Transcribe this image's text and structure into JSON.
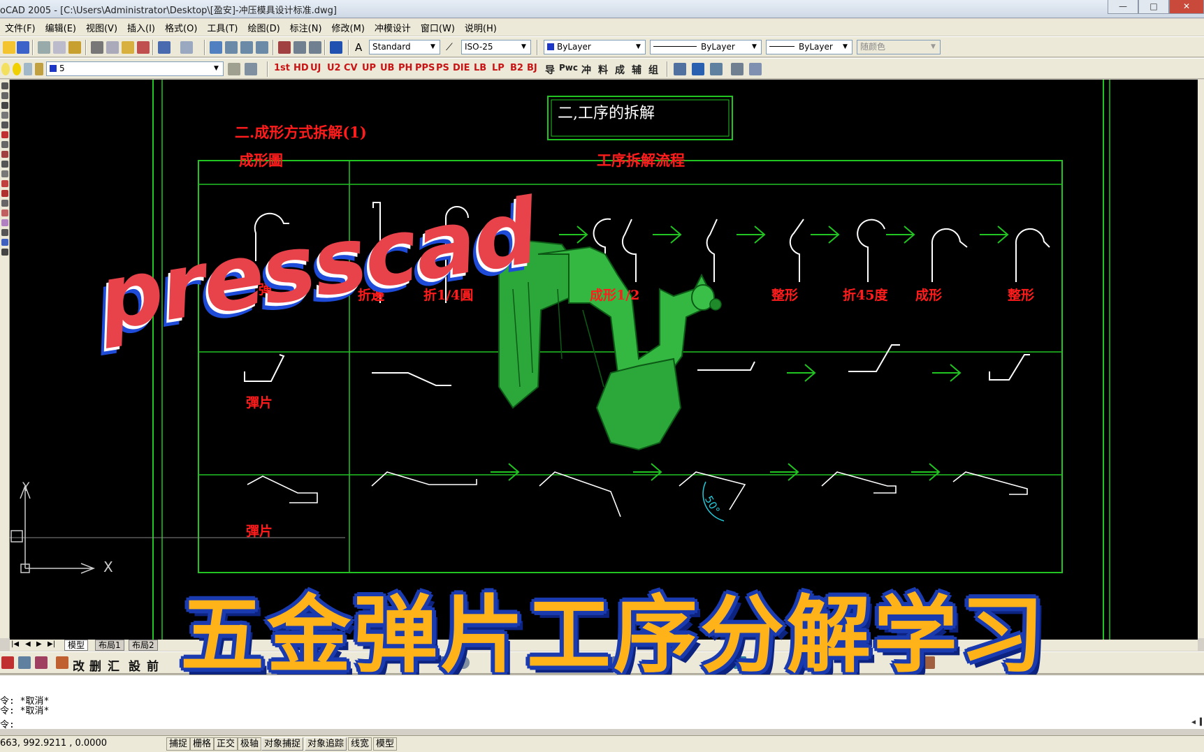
{
  "window": {
    "title": "oCAD 2005 - [C:\\Users\\Administrator\\Desktop\\[盈安]-冲压模具设计标准.dwg]",
    "controls": [
      "—",
      "□",
      "✕"
    ]
  },
  "menu": [
    "文件(F)",
    "编辑(E)",
    "视图(V)",
    "插入(I)",
    "格式(O)",
    "工具(T)",
    "绘图(D)",
    "标注(N)",
    "修改(M)",
    "冲模设计",
    "窗口(W)",
    "说明(H)"
  ],
  "toolbar1": {
    "text_style": "Standard",
    "dim_style": "ISO-25",
    "color": "ByLayer",
    "linetype": "ByLayer",
    "lineweight": "ByLayer",
    "plot_style": "随颜色"
  },
  "toolbar2": {
    "layer": "5",
    "press_buttons": [
      "1st",
      "HD",
      "UJ",
      "U2",
      "CV",
      "UP",
      "UB",
      "PH",
      "PPS",
      "PS",
      "DIE",
      "LB",
      "LP",
      "B2",
      "BJ"
    ],
    "cn_buttons": [
      "导",
      "Pwc",
      "冲",
      "料",
      "成",
      "辅",
      "组"
    ]
  },
  "drawing": {
    "section_title": "二,工序的拆解",
    "subtitle": "二.成形方式拆解(1)",
    "col_header_1": "成形圖",
    "col_header_2": "工序拆解流程",
    "row1_label": "弹",
    "row1_steps": [
      "折邊",
      "折1/4圓",
      "成形1/2",
      "",
      "整形",
      "折45度",
      "成形",
      "整形"
    ],
    "row2_label": "彈片",
    "row3_label": "彈片",
    "dimension": "50°",
    "ucs_y": "Y",
    "ucs_x": "X"
  },
  "overlay": {
    "brand": "presscad",
    "headline": "五金弹片工序分解学习"
  },
  "layout_tabs": [
    "模型",
    "布局1",
    "布局2"
  ],
  "toolbar3": [
    "改",
    "删",
    "汇",
    "設",
    "前"
  ],
  "command_line": {
    "lines": [
      "令: *取消*",
      "令: *取消*",
      "令:"
    ]
  },
  "status": {
    "coords": "663, 992.9211 , 0.0000",
    "buttons": [
      "捕捉",
      "栅格",
      "正交",
      "极轴",
      "对象捕捉",
      "对象追踪",
      "线宽",
      "模型"
    ],
    "active": [
      "对象捕捉",
      "对象追踪"
    ]
  },
  "colors": {
    "canvas": "#000000",
    "frame_green": "#22c422",
    "cad_red": "#ff1c1c",
    "part_green": "#2aa832",
    "brand_red": "#e8424a",
    "headline_yellow": "#ffb319",
    "headline_blue": "#1a3bb0"
  }
}
